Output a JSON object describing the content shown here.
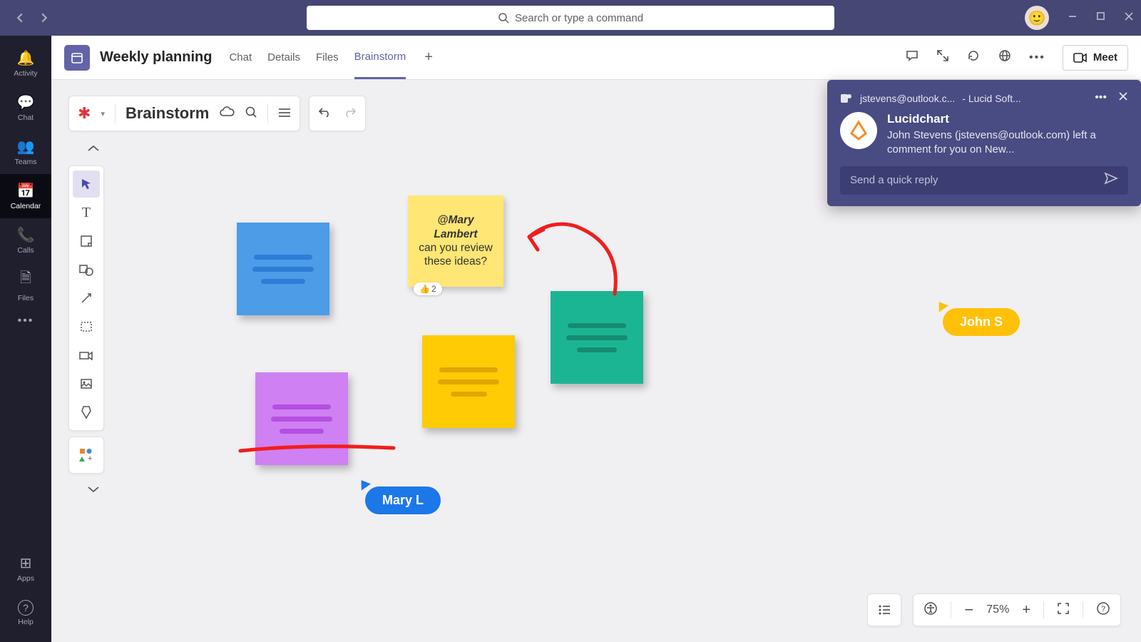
{
  "titlebar": {
    "search_placeholder": "Search or type a command"
  },
  "rail": {
    "items": [
      {
        "label": "Activity",
        "icon": "🔔"
      },
      {
        "label": "Chat",
        "icon": "💬"
      },
      {
        "label": "Teams",
        "icon": "👥"
      },
      {
        "label": "Calendar",
        "icon": "📅"
      },
      {
        "label": "Calls",
        "icon": "📞"
      },
      {
        "label": "Files",
        "icon": "🗎"
      }
    ],
    "more_icon": "•••",
    "bottom": [
      {
        "label": "Apps",
        "icon": "⊞"
      },
      {
        "label": "Help",
        "icon": "?"
      }
    ]
  },
  "tabheader": {
    "title": "Weekly planning",
    "tabs": [
      "Chat",
      "Details",
      "Files",
      "Brainstorm"
    ],
    "active_index": 3,
    "meet_label": "Meet"
  },
  "canvas_toolbar": {
    "doc_title": "Brainstorm",
    "app_glyph": "✱"
  },
  "shape_tools": {
    "items": [
      {
        "name": "select-tool",
        "glyph": "➤",
        "selected": true
      },
      {
        "name": "text-tool",
        "glyph": "T"
      },
      {
        "name": "note-tool",
        "glyph": "▢"
      },
      {
        "name": "shape-tool",
        "glyph": "◧"
      },
      {
        "name": "line-tool",
        "glyph": "↗"
      },
      {
        "name": "container-tool",
        "glyph": "⬚"
      },
      {
        "name": "dynamic-tool",
        "glyph": "⧉"
      },
      {
        "name": "image-tool",
        "glyph": "🖼"
      },
      {
        "name": "highlight-tool",
        "glyph": "Ẫ"
      }
    ],
    "shapes_lib_glyph": "▦"
  },
  "stickies": {
    "yellow_note": {
      "mention": "@Mary Lambert",
      "body": "can you review these ideas?",
      "reaction_emoji": "👍",
      "reaction_count": "2"
    }
  },
  "cursors": {
    "mary": "Mary L",
    "john": "John S"
  },
  "notification": {
    "source_email": "jstevens@outlook.c...",
    "source_app_short": "- Lucid Soft...",
    "title": "Lucidchart",
    "message": "John Stevens (jstevens@outlook.com) left a comment for you on New...",
    "reply_placeholder": "Send a quick reply"
  },
  "zoom": {
    "level": "75%"
  }
}
